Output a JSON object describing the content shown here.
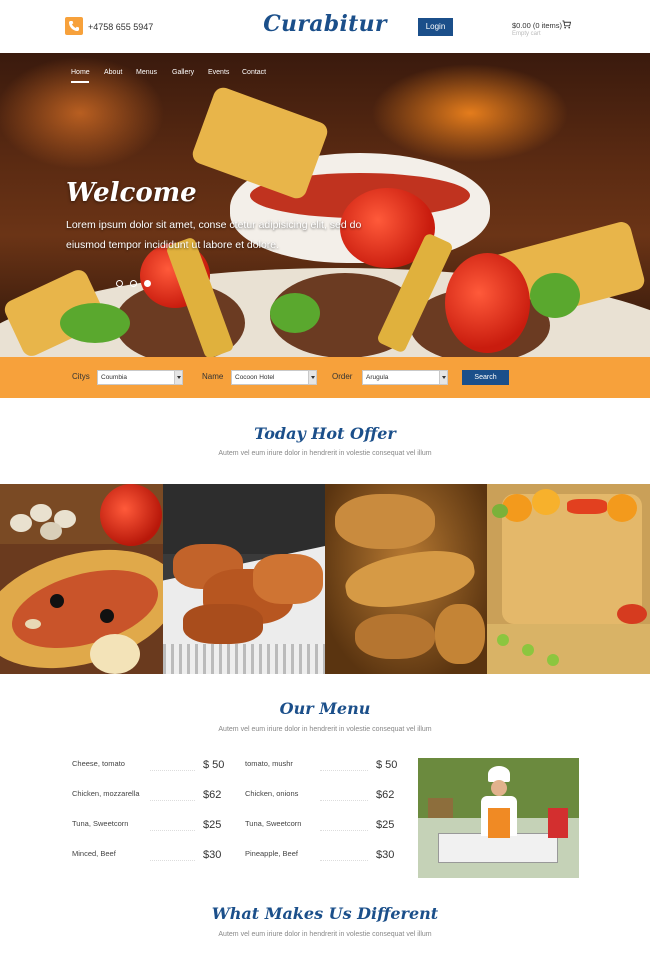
{
  "header": {
    "phone": "+4758 655 5947",
    "brand": "Curabitur",
    "login_label": "Login",
    "cart_total": "$0.00 (0 items)",
    "cart_sub": "Empty cart"
  },
  "nav": {
    "items": [
      {
        "label": "Home"
      },
      {
        "label": "About"
      },
      {
        "label": "Menus"
      },
      {
        "label": "Gallery"
      },
      {
        "label": "Events"
      },
      {
        "label": "Contact"
      }
    ]
  },
  "hero": {
    "title": "Welcome",
    "text": "Lorem ipsum dolor sit amet, conse ctetur adipisicing elit, sed do eiusmod tempor incididunt ut labore et dolore."
  },
  "search": {
    "city_label": "Citys",
    "city_value": "Coumbia",
    "name_label": "Name",
    "name_value": "Cocoon Hotel",
    "order_label": "Order",
    "order_value": "Arugula",
    "button_label": "Search"
  },
  "offer": {
    "title": "Today Hot Offer",
    "subtitle": "Autem vel eum iriure dolor in hendrerit in volestie consequat vel illum"
  },
  "menu": {
    "title": "Our Menu",
    "subtitle": "Autem vel eum iriure dolor in hendrerit in volestie consequat vel illum",
    "left": [
      {
        "name": "Cheese, tomato",
        "price": "$ 50"
      },
      {
        "name": "Chicken, mozzarella",
        "price": "$62"
      },
      {
        "name": "Tuna, Sweetcorn",
        "price": "$25"
      },
      {
        "name": "Minced, Beef",
        "price": "$30"
      }
    ],
    "right": [
      {
        "name": "tomato, mushr",
        "price": "$ 50"
      },
      {
        "name": "Chicken, onions",
        "price": "$62"
      },
      {
        "name": "Tuna, Sweetcorn",
        "price": "$25"
      },
      {
        "name": "Pineapple, Beef",
        "price": "$30"
      }
    ]
  },
  "different": {
    "title": "What Makes Us Different",
    "subtitle": "Autem vel eum iriure dolor in hendrerit in volestie consequat vel illum"
  },
  "colors": {
    "brand_blue": "#1b4f8a",
    "accent_orange": "#f7a13b"
  }
}
